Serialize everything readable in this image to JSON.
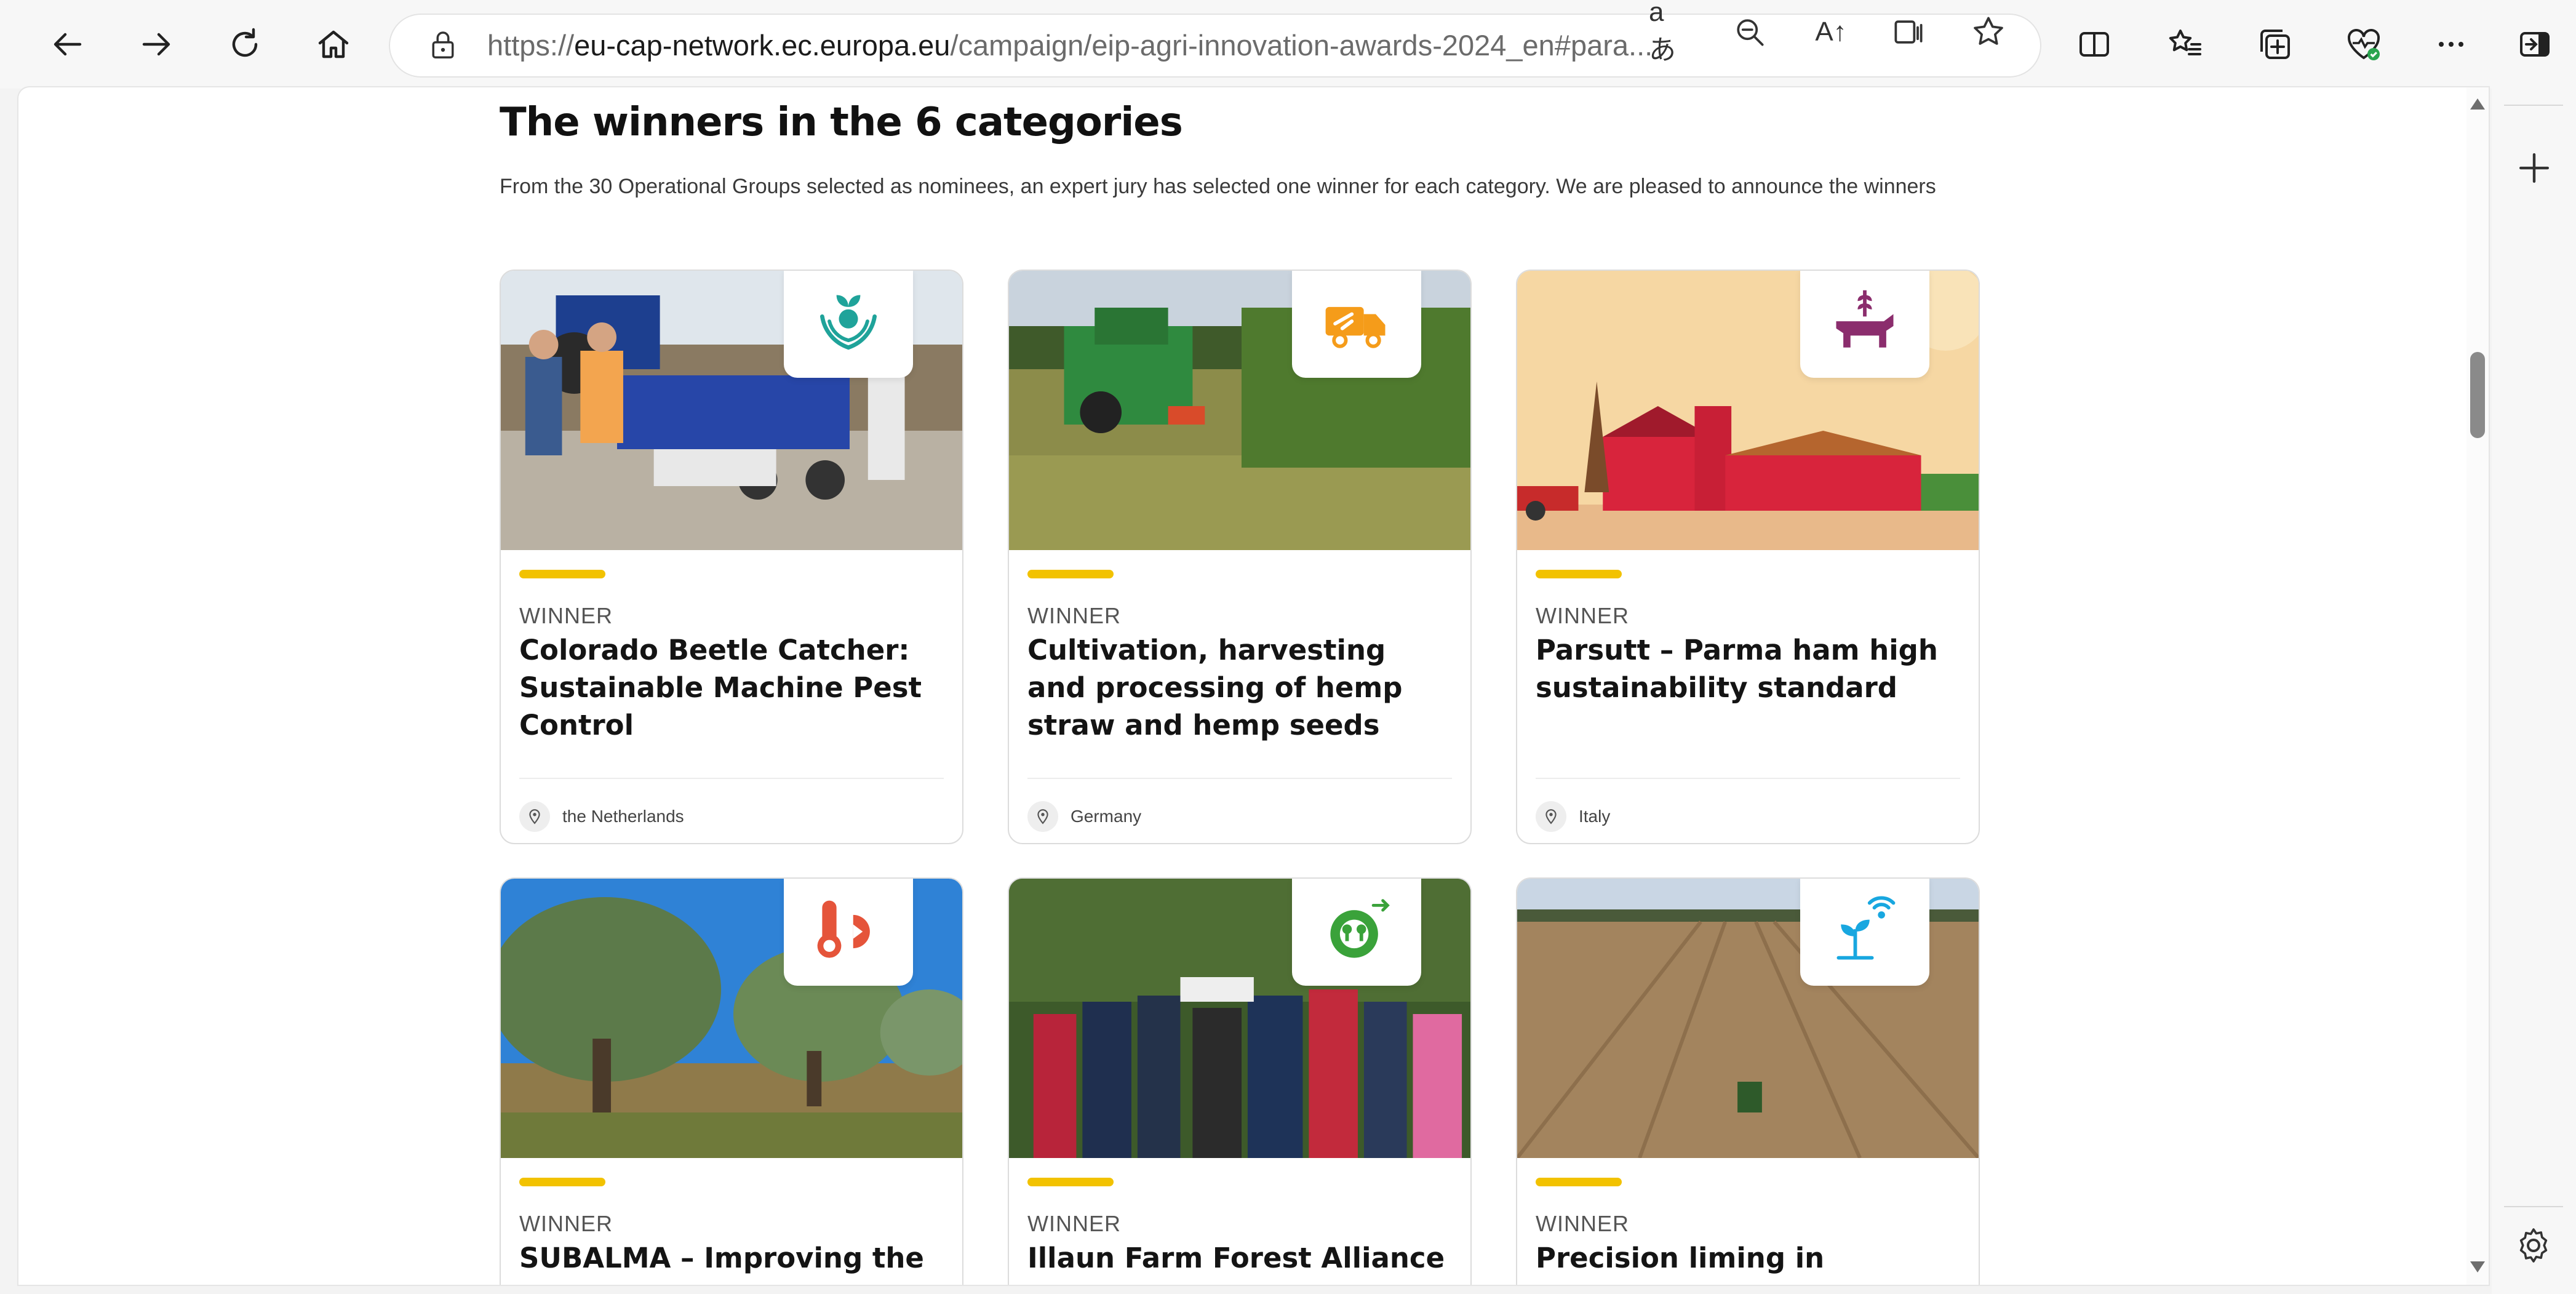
{
  "browser": {
    "url_scheme": "https://",
    "url_host": "eu-cap-network.ec.europa.eu",
    "url_path": "/campaign/eip-agri-innovation-awards-2024_en#para...",
    "read_aloud_glyph": "A↑",
    "translate_glyph": "aあ"
  },
  "page": {
    "heading": "The winners in the 6 categories",
    "intro": "From the 30 Operational Groups selected as nominees, an expert jury has selected one winner for each category. We are pleased to announce the winners"
  },
  "cards": [
    {
      "label": "WINNER",
      "title": "Colorado Beetle Catcher: Sustainable Machine Pest Control",
      "country": "the Netherlands",
      "icon": "hands-holding-plant-icon"
    },
    {
      "label": "WINNER",
      "title": "Cultivation, harvesting and processing of hemp straw and hemp seeds",
      "country": "Germany",
      "icon": "delivery-truck-icon"
    },
    {
      "label": "WINNER",
      "title": "Parsutt – Parma ham high sustainability standard",
      "country": "Italy",
      "icon": "cow-wheat-icon"
    },
    {
      "label": "WINNER",
      "title": "SUBALMA – Improving the",
      "country": "",
      "icon": "thermometer-wrench-icon"
    },
    {
      "label": "WINNER",
      "title": "Illaun Farm Forest Alliance",
      "country": "",
      "icon": "gear-trees-icon"
    },
    {
      "label": "WINNER",
      "title": "Precision liming in",
      "country": "",
      "icon": "plant-wifi-icon"
    }
  ],
  "colors": {
    "accent": "#f2c200",
    "icon_teal": "#1fa39a",
    "icon_orange": "#f59c1a",
    "icon_purple": "#8b2d6d",
    "icon_red": "#e5543a",
    "icon_green": "#3aa23a",
    "icon_blue": "#18a7e0"
  }
}
